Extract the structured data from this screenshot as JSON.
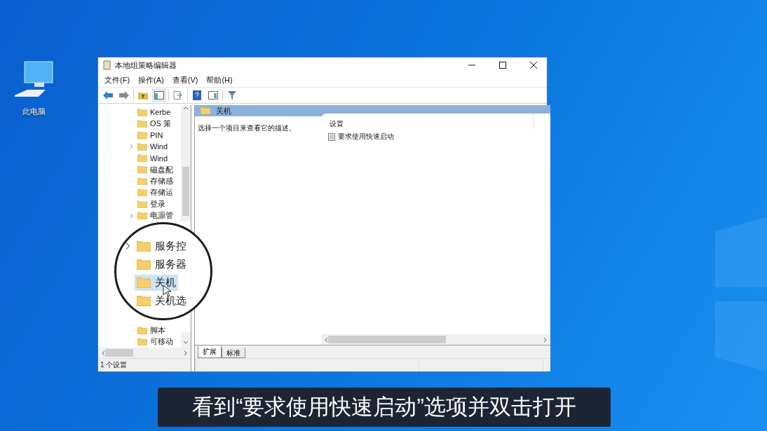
{
  "desktop": {
    "icons": [
      {
        "label": "此电脑"
      }
    ]
  },
  "window": {
    "title": "本地组策略编辑器",
    "menu": [
      "文件(F)",
      "操作(A)",
      "查看(V)",
      "帮助(H)"
    ],
    "tree": {
      "items": [
        {
          "label": "Kerbe",
          "expandable": false
        },
        {
          "label": "OS 策",
          "expandable": false
        },
        {
          "label": "PIN",
          "expandable": false
        },
        {
          "label": "Wind",
          "expandable": true
        },
        {
          "label": "Wind",
          "expandable": false
        },
        {
          "label": "磁盘配",
          "expandable": false
        },
        {
          "label": "存储感",
          "expandable": false
        },
        {
          "label": "存储运",
          "expandable": false
        },
        {
          "label": "登录",
          "expandable": false
        },
        {
          "label": "电源管",
          "expandable": true
        }
      ],
      "lower_items": [
        {
          "label": "脚本",
          "expandable": false
        },
        {
          "label": "可移动",
          "expandable": false
        }
      ]
    },
    "magnifier": {
      "items": [
        {
          "label": "服务控",
          "expandable": true,
          "selected": false
        },
        {
          "label": "服务器",
          "expandable": false,
          "selected": false
        },
        {
          "label": "关机",
          "expandable": false,
          "selected": true
        },
        {
          "label": "关机选",
          "expandable": false,
          "selected": false
        }
      ]
    },
    "header": {
      "title": "关机"
    },
    "description": "选择一个项目来查看它的描述。",
    "list": {
      "columns": [
        "设置"
      ],
      "rows": [
        {
          "name": "要求使用快速启动"
        }
      ]
    },
    "tabs": [
      {
        "label": "扩展",
        "selected": true
      },
      {
        "label": "标准",
        "selected": false
      }
    ],
    "status_bar": {
      "text": "1 个设置"
    }
  },
  "subtitle": "看到“要求使用快速启动”选项并双击打开"
}
